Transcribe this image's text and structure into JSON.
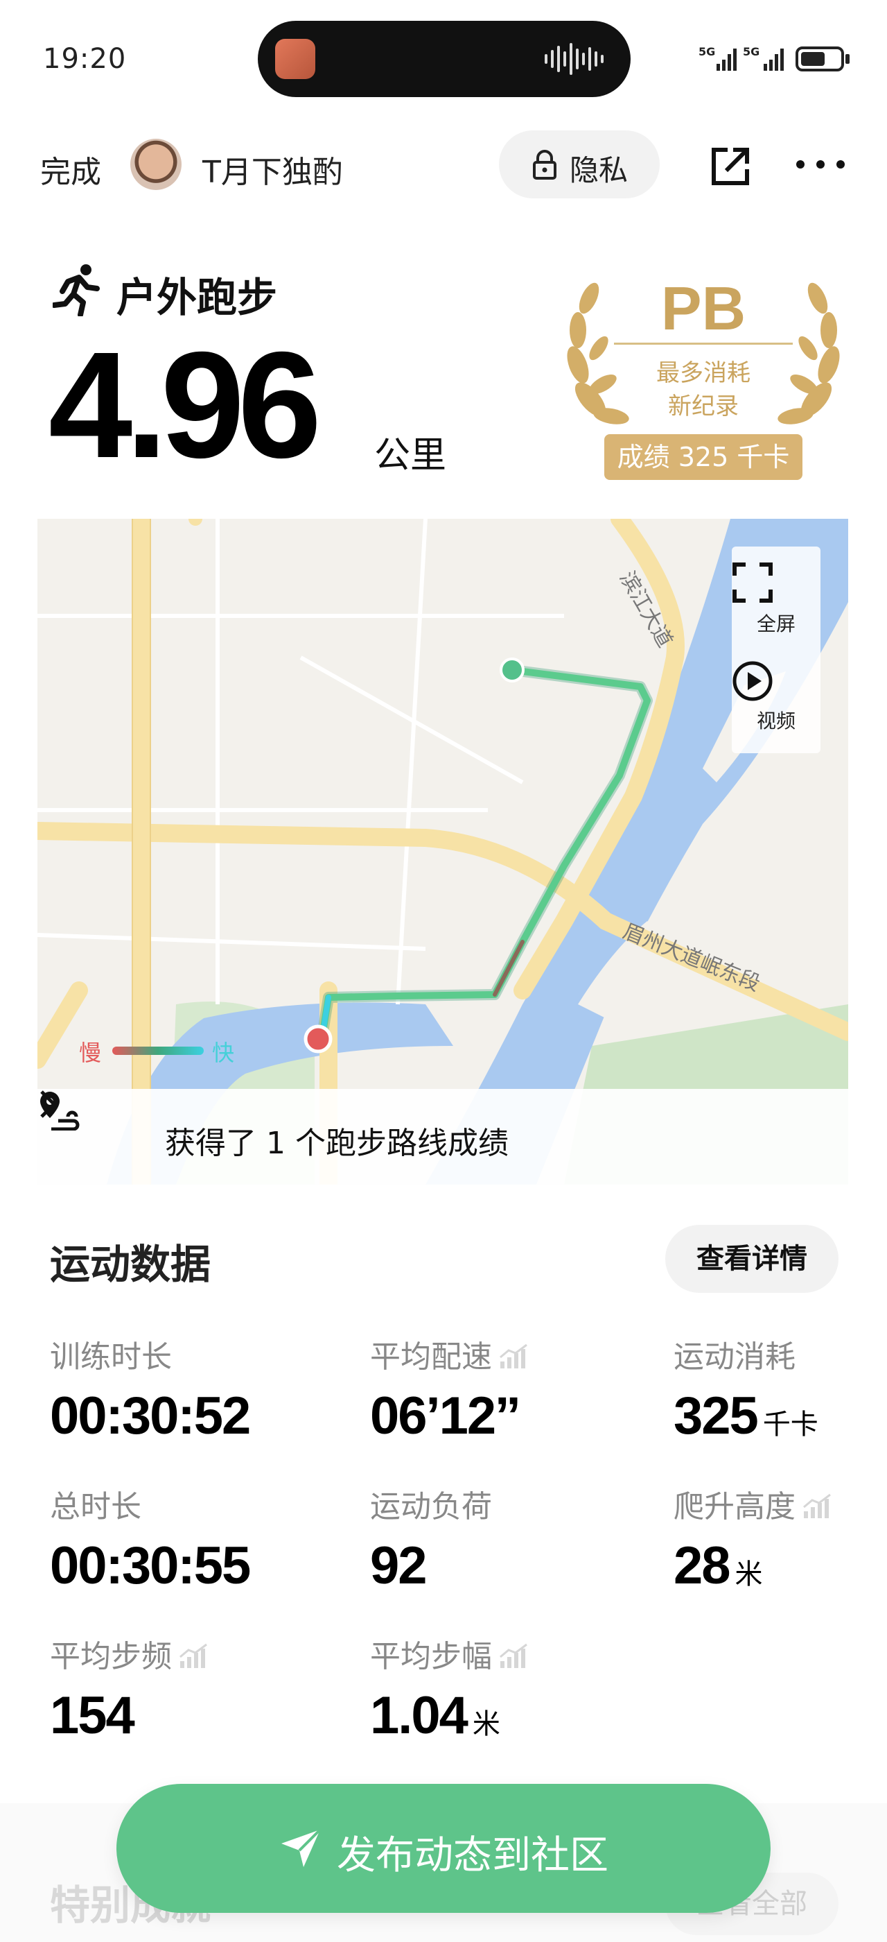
{
  "status_bar": {
    "time": "19:20",
    "signal_1": "5G",
    "signal_2": "5G"
  },
  "header": {
    "done_label": "完成",
    "username": "T月下独酌",
    "privacy_label": "隐私"
  },
  "activity": {
    "title": "户外跑步",
    "distance": "4.96",
    "distance_unit": "公里"
  },
  "pb_badge": {
    "title": "PB",
    "line1": "最多消耗",
    "line2": "新纪录",
    "score": "成绩 325 千卡"
  },
  "map": {
    "fullscreen_label": "全屏",
    "video_label": "视频",
    "legend_slow": "慢",
    "legend_fast": "快",
    "road_label_1": "滨江大道",
    "road_label_2": "眉州大道岷东段",
    "route_banner": "获得了 1 个跑步路线成绩"
  },
  "stats": {
    "section_title": "运动数据",
    "detail_button": "查看详情",
    "items": [
      {
        "label": "训练时长",
        "value": "00:30:52",
        "unit": ""
      },
      {
        "label": "平均配速",
        "value": "06’12’’",
        "unit": ""
      },
      {
        "label": "运动消耗",
        "value": "325",
        "unit": "千卡"
      },
      {
        "label": "总时长",
        "value": "00:30:55",
        "unit": ""
      },
      {
        "label": "运动负荷",
        "value": "92",
        "unit": ""
      },
      {
        "label": "爬升高度",
        "value": "28",
        "unit": "米"
      },
      {
        "label": "平均步频",
        "value": "154",
        "unit": ""
      },
      {
        "label": "平均步幅",
        "value": "1.04",
        "unit": "米"
      }
    ]
  },
  "bottom": {
    "publish_label": "发布动态到社区",
    "next_section_title": "特别成就",
    "next_section_button": "查看全部"
  },
  "colors": {
    "accent_green": "#5ec48a",
    "pb_gold": "#caa45e",
    "route_green": "#4cc38a",
    "water": "#a9c9f0",
    "road": "#f7e2a6"
  }
}
